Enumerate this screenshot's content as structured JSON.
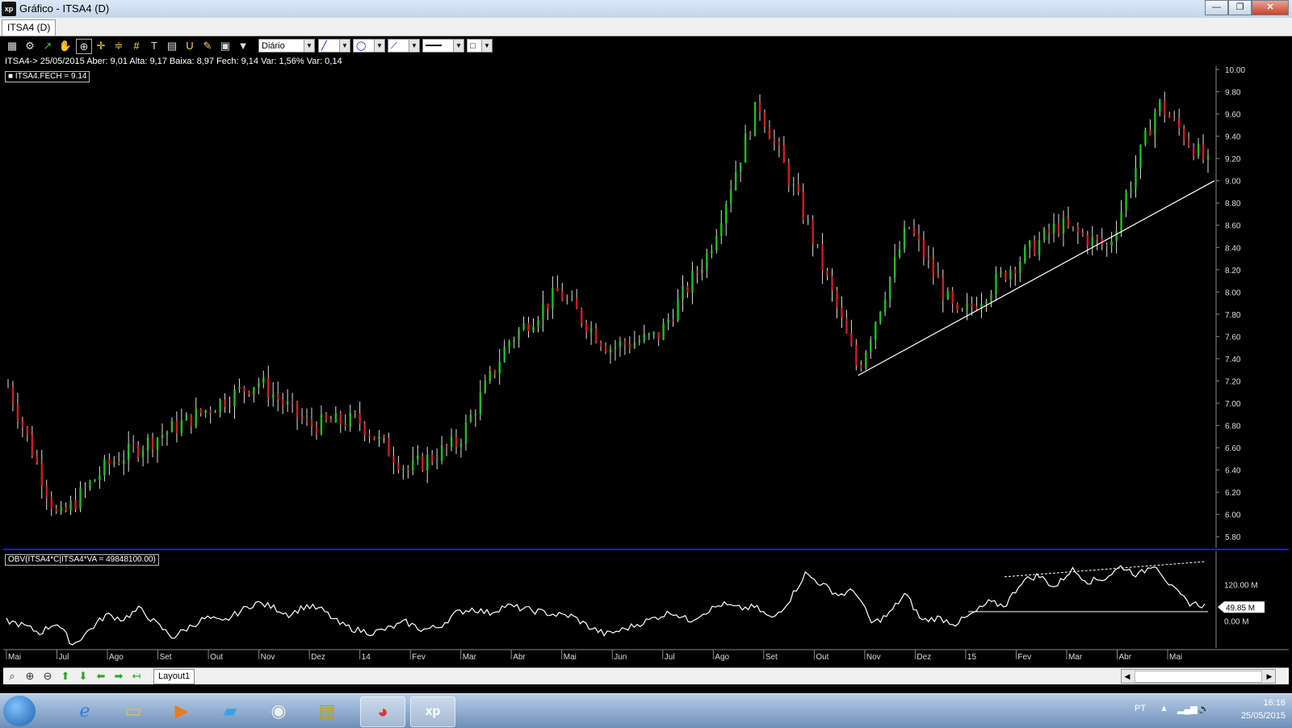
{
  "window": {
    "title": "Gráfico - ITSA4 (D)",
    "app_icon_text": "xp",
    "buttons": {
      "minimize": "—",
      "restore": "❐",
      "close": "✕"
    }
  },
  "tab": {
    "label": "ITSA4 (D)"
  },
  "toolbar": {
    "period_value": "Diário",
    "icons": [
      "chart-type-icon",
      "settings-icon",
      "indicator-icon",
      "hand-icon",
      "zoom-crosshair-icon",
      "crosshair-icon",
      "horizontal-line-icon",
      "grid-icon",
      "text-icon",
      "calculator-icon",
      "u-icon",
      "pencil-icon",
      "lock-icon",
      "filter-icon"
    ]
  },
  "info": {
    "line": "ITSA4-> 25/05/2015 Aber: 9,01 Alta: 9,17 Baixa: 8,97 Fech: 9,14 Var: 1,56% Var: 0,14"
  },
  "price_pane": {
    "legend": "■ ITSA4.FECH = 9.14",
    "last_value_label": "9.14",
    "last_value": 9.14
  },
  "obv_pane": {
    "legend": "OBV(ITSA4*C|ITSA4*VA = 49848100.00)",
    "last_value_label": "49.85 M"
  },
  "chart_data": [
    {
      "type": "candlestick",
      "series_name": "ITSA4.FECH",
      "ylim": [
        5.7,
        10.0
      ],
      "yticks": [
        "10.00",
        "9.80",
        "9.60",
        "9.40",
        "9.20",
        "9.00",
        "8.80",
        "8.60",
        "8.40",
        "8.20",
        "8.00",
        "7.80",
        "7.60",
        "7.40",
        "7.20",
        "7.00",
        "6.80",
        "6.60",
        "6.40",
        "6.20",
        "6.00",
        "5.80"
      ],
      "ytick_values": [
        10.0,
        9.8,
        9.6,
        9.4,
        9.2,
        9.0,
        8.8,
        8.6,
        8.4,
        8.2,
        8.0,
        7.8,
        7.6,
        7.4,
        7.2,
        7.0,
        6.8,
        6.6,
        6.4,
        6.2,
        6.0,
        5.8
      ],
      "colors": {
        "up": "#1fbf1f",
        "down": "#d21c1c",
        "trendline": "#ffffff"
      },
      "trendline": {
        "from": {
          "month": "Out",
          "value": 7.25
        },
        "to": {
          "month": "Mai",
          "value": 9.0
        }
      },
      "monthly_path": [
        {
          "month": "Mai",
          "value": 7.15
        },
        {
          "month": "Jul",
          "value": 5.95
        },
        {
          "month": "Ago",
          "value": 6.45
        },
        {
          "month": "Set",
          "value": 6.7
        },
        {
          "month": "Out",
          "value": 6.95
        },
        {
          "month": "Nov",
          "value": 7.2
        },
        {
          "month": "Dez",
          "value": 6.8
        },
        {
          "month": "14",
          "value": 6.85
        },
        {
          "month": "Fev",
          "value": 6.4
        },
        {
          "month": "Mar",
          "value": 6.65
        },
        {
          "month": "Abr",
          "value": 7.55
        },
        {
          "month": "Mai",
          "value": 8.0
        },
        {
          "month": "Jun",
          "value": 7.5
        },
        {
          "month": "Jul",
          "value": 7.6
        },
        {
          "month": "Ago",
          "value": 8.35
        },
        {
          "month": "Set",
          "value": 9.7
        },
        {
          "month": "Out",
          "value": 8.6
        },
        {
          "month": "Out",
          "value": 7.3
        },
        {
          "month": "Nov",
          "value": 8.6
        },
        {
          "month": "Dez",
          "value": 7.75
        },
        {
          "month": "15",
          "value": 8.2
        },
        {
          "month": "Fev",
          "value": 8.6
        },
        {
          "month": "Mar",
          "value": 8.4
        },
        {
          "month": "Abr",
          "value": 9.7
        },
        {
          "month": "Mai",
          "value": 9.14
        }
      ]
    },
    {
      "type": "line",
      "series_name": "OBV",
      "yticks": [
        "120.00 M",
        "0.00 M"
      ],
      "ytick_values": [
        120,
        0
      ],
      "ylim": [
        -90,
        230
      ],
      "color": "#ffffff",
      "values_millions": [
        0,
        -15,
        -40,
        -5,
        -80,
        -30,
        20,
        5,
        40,
        -10,
        -55,
        -20,
        10,
        -5,
        30,
        60,
        45,
        20,
        50,
        35,
        -10,
        -30,
        -40,
        -25,
        -5,
        -30,
        -20,
        25,
        40,
        25,
        50,
        40,
        30,
        20,
        15,
        -20,
        -45,
        -30,
        -10,
        10,
        30,
        0,
        30,
        55,
        40,
        45,
        5,
        65,
        155,
        120,
        85,
        100,
        -10,
        20,
        90,
        0,
        10,
        -10,
        20,
        60,
        50,
        130,
        150,
        110,
        170,
        130,
        140,
        180,
        150,
        190,
        110,
        60,
        50
      ]
    },
    {
      "type": "x_axis",
      "labels": [
        "Mai",
        "Jul",
        "Ago",
        "Set",
        "Out",
        "Nov",
        "Dez",
        "14",
        "Fev",
        "Mar",
        "Abr",
        "Mai",
        "Jun",
        "Jul",
        "Ago",
        "Set",
        "Out",
        "Nov",
        "Dez",
        "15",
        "Fev",
        "Mar",
        "Abr",
        "Mai"
      ]
    }
  ],
  "bottom": {
    "layout_tab": "Layout1",
    "icons": [
      "zoom-icon",
      "zoom-in-icon",
      "zoom-out-icon",
      "arrow-up-icon",
      "arrow-down-icon",
      "arrow-left-icon",
      "arrow-right-icon",
      "arrow-return-icon"
    ]
  },
  "taskbar": {
    "language": "PT",
    "time": "16:16",
    "date": "25/05/2015"
  }
}
